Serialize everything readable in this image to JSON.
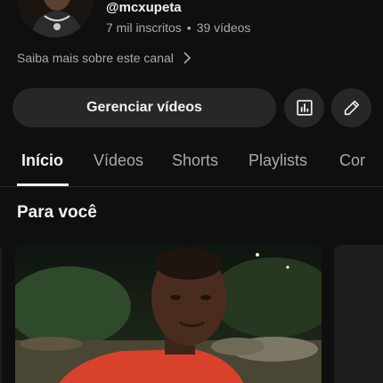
{
  "channel": {
    "handle": "@mcxupeta",
    "subscribers": "7 mil inscritos",
    "separator": "•",
    "videos_count": "39 vídeos",
    "more_link": "Saiba mais sobre este canal"
  },
  "actions": {
    "manage_label": "Gerenciar vídeos",
    "stats_icon": "bar-chart-icon",
    "edit_icon": "pencil-icon"
  },
  "tabs": [
    {
      "label": "Início",
      "active": true
    },
    {
      "label": "Vídeos",
      "active": false
    },
    {
      "label": "Shorts",
      "active": false
    },
    {
      "label": "Playlists",
      "active": false
    },
    {
      "label": "Cor",
      "active": false
    }
  ],
  "section": {
    "title": "Para você"
  },
  "colors": {
    "background": "#0f0f0f",
    "button_bg": "#272727",
    "text_primary": "#f1f1f1",
    "text_secondary": "#aaaaaa"
  }
}
